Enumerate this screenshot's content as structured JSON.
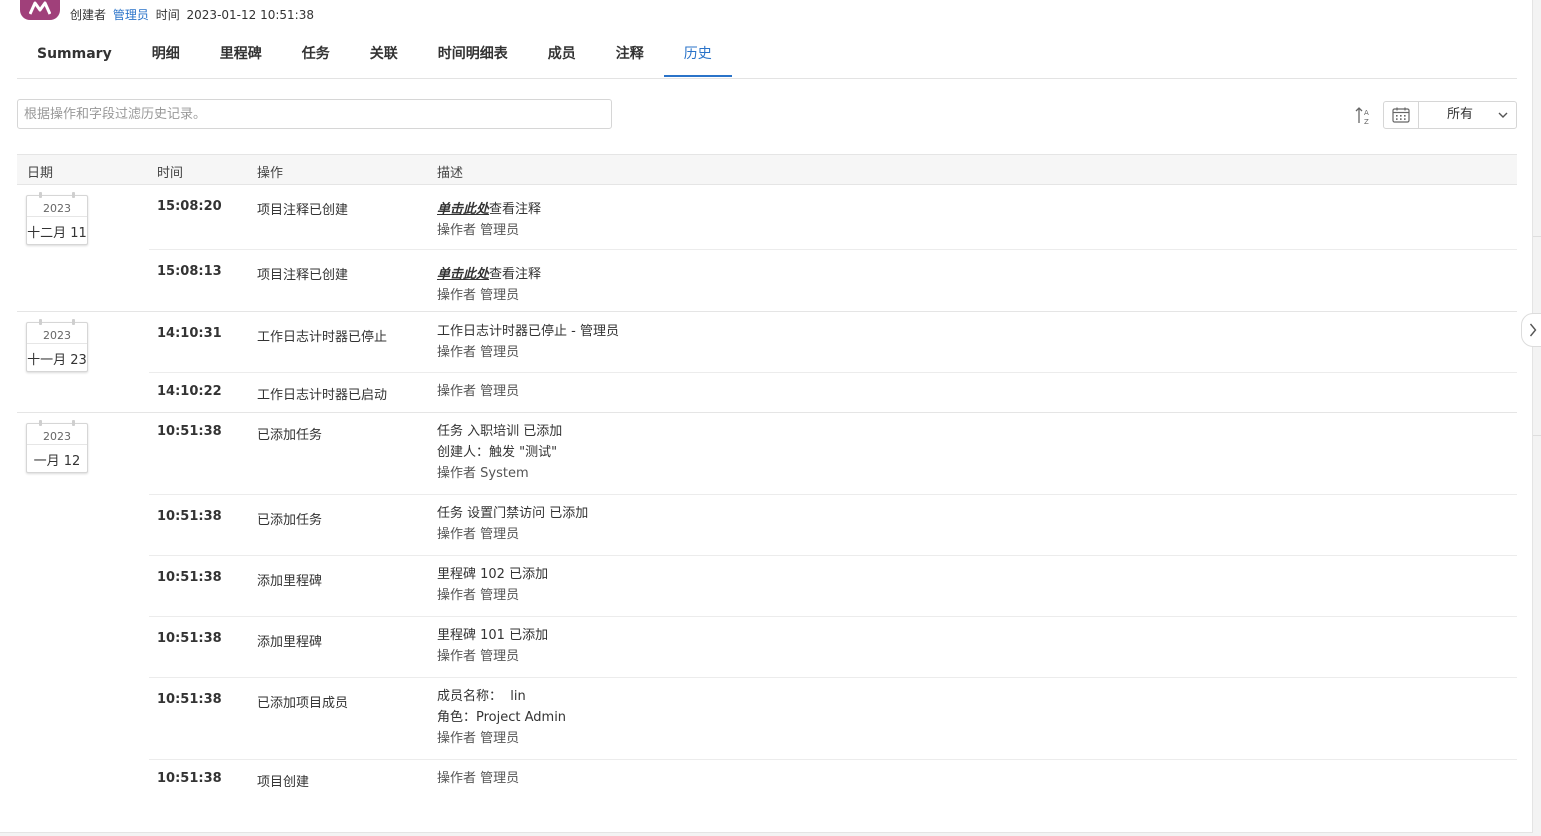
{
  "header": {
    "creator_label": "创建者",
    "creator_name": "管理员",
    "time_label": "时间",
    "time_value": "2023-01-12 10:51:38"
  },
  "tabs": [
    {
      "label": "Summary"
    },
    {
      "label": "明细"
    },
    {
      "label": "里程碑"
    },
    {
      "label": "任务"
    },
    {
      "label": "关联"
    },
    {
      "label": "时间明细表"
    },
    {
      "label": "成员"
    },
    {
      "label": "注释"
    },
    {
      "label": "历史",
      "active": true
    }
  ],
  "filter": {
    "placeholder": "根据操作和字段过滤历史记录。",
    "value": ""
  },
  "date_filter": {
    "selected": "所有"
  },
  "columns": {
    "date": "日期",
    "time": "时间",
    "action": "操作",
    "description": "描述"
  },
  "groups": [
    {
      "year": "2023",
      "month_day": "十二月 11",
      "rows": [
        {
          "time": "15:08:20",
          "action": "项目注释已创建",
          "link": "单击此处",
          "desc_suffix": "查看注释",
          "by_label": "操作者",
          "by": "管理员"
        },
        {
          "time": "15:08:13",
          "action": "项目注释已创建",
          "link": "单击此处",
          "desc_suffix": "查看注释",
          "by_label": "操作者",
          "by": "管理员"
        }
      ]
    },
    {
      "year": "2023",
      "month_day": "十一月 23",
      "rows": [
        {
          "time": "14:10:31",
          "action": "工作日志计时器已停止",
          "desc": "工作日志计时器已停止 - 管理员",
          "by_label": "操作者",
          "by": "管理员"
        },
        {
          "time": "14:10:22",
          "action": "工作日志计时器已启动",
          "by_label": "操作者",
          "by": "管理员"
        }
      ]
    },
    {
      "year": "2023",
      "month_day": "一月 12",
      "rows": [
        {
          "time": "10:51:38",
          "action": "已添加任务",
          "desc": "任务 入职培训 已添加",
          "desc2": "创建人：触发 \"测试\"",
          "by_label": "操作者",
          "by": "System"
        },
        {
          "time": "10:51:38",
          "action": "已添加任务",
          "desc": "任务 设置门禁访问 已添加",
          "by_label": "操作者",
          "by": "管理员"
        },
        {
          "time": "10:51:38",
          "action": "添加里程碑",
          "desc": "里程碑 102 已添加",
          "by_label": "操作者",
          "by": "管理员"
        },
        {
          "time": "10:51:38",
          "action": "添加里程碑",
          "desc": "里程碑 101 已添加",
          "by_label": "操作者",
          "by": "管理员"
        },
        {
          "time": "10:51:38",
          "action": "已添加项目成员",
          "desc": "成员名称：  lin",
          "desc2": "角色：Project Admin",
          "by_label": "操作者",
          "by": "管理员"
        },
        {
          "time": "10:51:38",
          "action": "项目创建",
          "by_label": "操作者",
          "by": "管理员"
        }
      ]
    }
  ],
  "colors": {
    "accent": "#2a73c9",
    "logo": "#a0407a"
  }
}
